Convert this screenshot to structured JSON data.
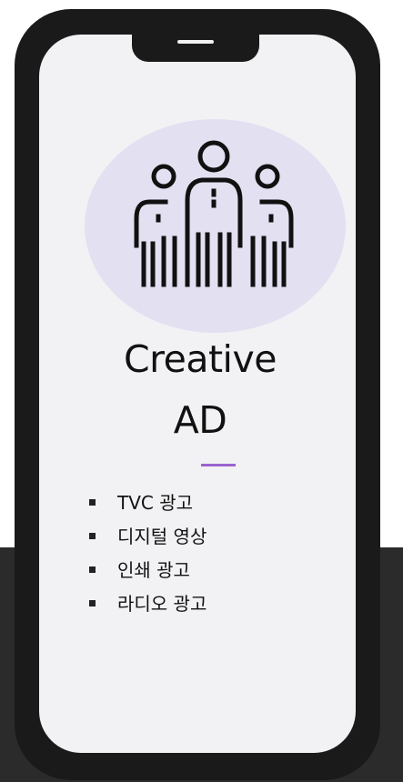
{
  "card": {
    "title_line1": "Creative",
    "title_line2": "AD",
    "icon": "team-people-icon",
    "accent_color": "#9b63d1",
    "icon_bg_color": "#e3e0f1"
  },
  "services": [
    "TVC 광고",
    "디지털 영상",
    "인쇄 광고",
    "라디오 광고"
  ]
}
